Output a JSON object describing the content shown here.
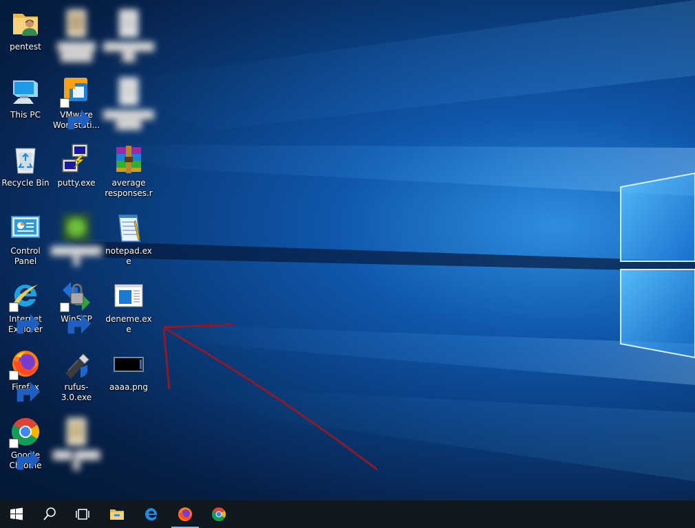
{
  "colors": {
    "taskbar_bg": "#101820",
    "accent": "#76b9ed",
    "arrow": "#8b1a2b",
    "icon_label": "#ffffff"
  },
  "desktop": {
    "icons": {
      "pentest": {
        "label": "pentest",
        "icon": "user-folder-icon"
      },
      "this_pc": {
        "label": "This PC",
        "icon": "computer-icon"
      },
      "recycle_bin": {
        "label": "Recycle Bin",
        "icon": "recycle-bin-icon"
      },
      "control_panel": {
        "label": "Control Panel",
        "icon": "control-panel-icon"
      },
      "internet_explorer": {
        "label": "Internet Explorer",
        "icon": "internet-explorer-icon"
      },
      "firefox": {
        "label": "Firefox",
        "icon": "firefox-icon"
      },
      "google_chrome": {
        "label": "Google Chrome",
        "icon": "chrome-icon"
      },
      "vmware": {
        "label": "VMware Workstati...",
        "icon": "vmware-icon"
      },
      "putty": {
        "label": "putty.exe",
        "icon": "putty-icon"
      },
      "winscp": {
        "label": "WinSCP",
        "icon": "winscp-icon"
      },
      "rufus": {
        "label": "rufus-3.0.exe",
        "icon": "usb-drive-icon"
      },
      "average_responses": {
        "label": "average responses.rar",
        "icon": "winrar-archive-icon"
      },
      "notepad": {
        "label": "notepad.exe",
        "icon": "notepad-icon"
      },
      "deneme": {
        "label": "deneme.exe",
        "icon": "application-window-icon"
      },
      "aaaa": {
        "label": "aaaa.png",
        "icon": "image-file-icon"
      }
    },
    "blurred_icons": [
      "redacted-file-icon",
      "redacted-file-icon",
      "redacted-file-icon",
      "redacted-app-icon",
      "redacted-file-icon"
    ]
  },
  "taskbar": {
    "items": [
      "start-icon",
      "search-icon",
      "task-view-icon",
      "file-explorer-icon",
      "edge-icon",
      "firefox-icon",
      "chrome-icon"
    ],
    "active": "firefox-icon"
  }
}
